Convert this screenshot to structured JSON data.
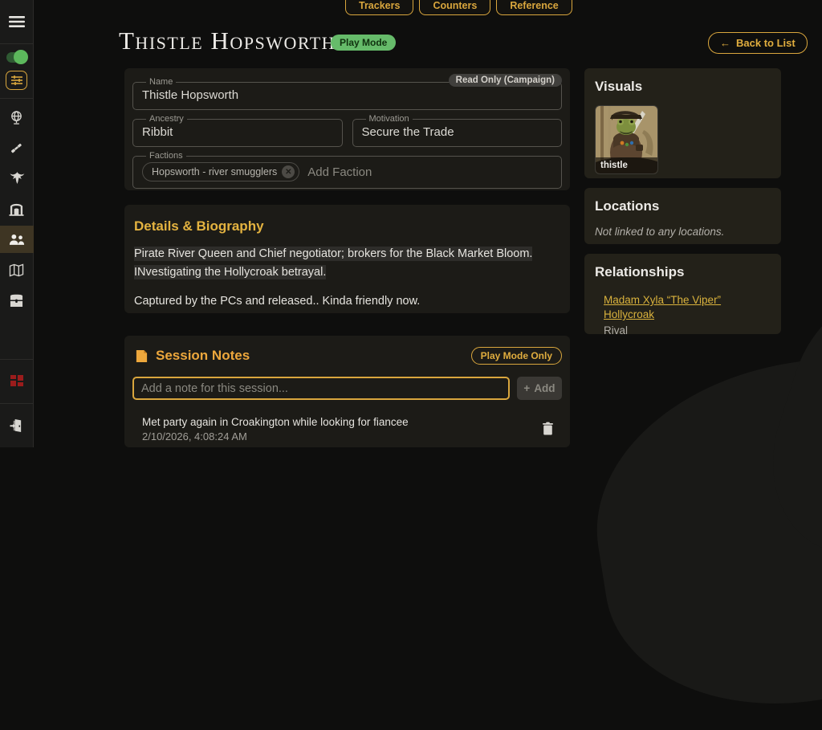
{
  "colors": {
    "accent_gold": "#d9a63d",
    "play_mode_green": "#66bb6a",
    "modules_red": "#9b1c1c",
    "card_bg": "#1c1b17",
    "page_bg": "#0e0e0d"
  },
  "topbar": {
    "buttons": [
      {
        "label": "Trackers"
      },
      {
        "label": "Counters"
      },
      {
        "label": "Reference"
      }
    ]
  },
  "sidebar": {
    "icons": [
      {
        "name": "hamburger-menu-icon"
      },
      {
        "name": "play-mode-toggle",
        "state": "on"
      },
      {
        "name": "filters-sliders-icon"
      },
      {
        "name": "globe-icon"
      },
      {
        "name": "spyglass-icon"
      },
      {
        "name": "dragon-icon"
      },
      {
        "name": "gate-icon"
      },
      {
        "name": "characters-icon",
        "active": true
      },
      {
        "name": "map-icon"
      },
      {
        "name": "treasure-chest-icon"
      },
      {
        "name": "modules-grid-icon"
      },
      {
        "name": "exit-door-icon"
      }
    ]
  },
  "header": {
    "title": "Thistle Hopsworth",
    "mode_badge": "Play Mode",
    "back_label": "Back to List",
    "back_arrow": "←"
  },
  "form": {
    "readonly_badge": "Read Only (Campaign)",
    "name": {
      "label": "Name",
      "value": "Thistle Hopsworth"
    },
    "ancestry": {
      "label": "Ancestry",
      "value": "Ribbit"
    },
    "motivation": {
      "label": "Motivation",
      "value": "Secure the Trade"
    },
    "factions": {
      "label": "Factions",
      "chips": [
        {
          "label": "Hopsworth - river smugglers"
        }
      ],
      "placeholder": "Add Faction"
    }
  },
  "details": {
    "title": "Details & Biography",
    "paragraphs": [
      {
        "text": "Pirate River Queen and Chief negotiator; brokers for the Black Market Bloom. INvestigating the Hollycroak betrayal.",
        "highlighted": true
      },
      {
        "text": "Captured by the PCs and released.. Kinda friendly now.",
        "highlighted": false
      }
    ]
  },
  "session_notes": {
    "title": "Session Notes",
    "badge": "Play Mode Only",
    "input_placeholder": "Add a note for this session...",
    "add_label": "Add",
    "plus_glyph": "+",
    "notes": [
      {
        "text": "Met party again in Croakington while looking for fiancee",
        "timestamp": "2/10/2026, 4:08:24 AM"
      }
    ]
  },
  "visuals": {
    "title": "Visuals",
    "images": [
      {
        "caption": "thistle"
      }
    ]
  },
  "locations": {
    "title": "Locations",
    "empty_text": "Not linked to any locations."
  },
  "relationships": {
    "title": "Relationships",
    "items": [
      {
        "name": "Madam Xyla “The Viper” Hollycroak",
        "type": "Rival"
      }
    ]
  }
}
